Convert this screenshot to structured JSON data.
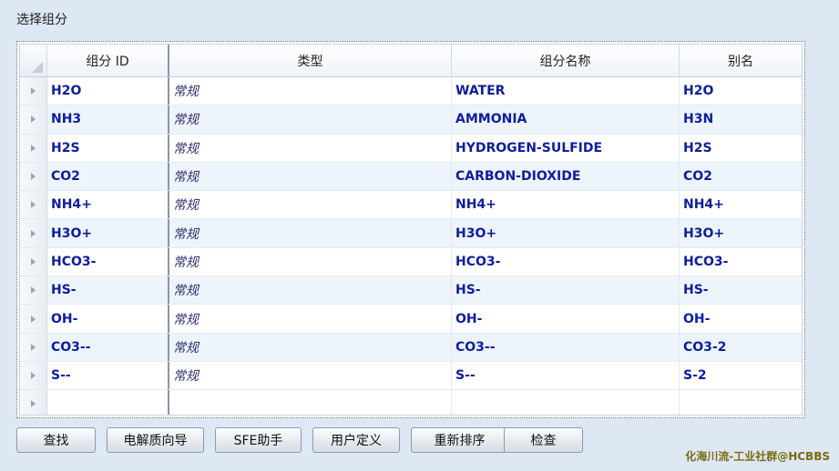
{
  "panel_title": "选择组分",
  "columns": {
    "id": "组分 ID",
    "type": "类型",
    "name": "组分名称",
    "alias": "别名"
  },
  "rows": [
    {
      "id": "H2O",
      "type": "常规",
      "name": "WATER",
      "alias": "H2O"
    },
    {
      "id": "NH3",
      "type": "常规",
      "name": "AMMONIA",
      "alias": "H3N"
    },
    {
      "id": "H2S",
      "type": "常规",
      "name": "HYDROGEN-SULFIDE",
      "alias": "H2S"
    },
    {
      "id": "CO2",
      "type": "常规",
      "name": "CARBON-DIOXIDE",
      "alias": "CO2"
    },
    {
      "id": "NH4+",
      "type": "常规",
      "name": "NH4+",
      "alias": "NH4+"
    },
    {
      "id": "H3O+",
      "type": "常规",
      "name": "H3O+",
      "alias": "H3O+"
    },
    {
      "id": "HCO3-",
      "type": "常规",
      "name": "HCO3-",
      "alias": "HCO3-"
    },
    {
      "id": "HS-",
      "type": "常规",
      "name": "HS-",
      "alias": "HS-"
    },
    {
      "id": "OH-",
      "type": "常规",
      "name": "OH-",
      "alias": "OH-"
    },
    {
      "id": "CO3--",
      "type": "常规",
      "name": "CO3--",
      "alias": "CO3-2"
    },
    {
      "id": "S--",
      "type": "常规",
      "name": "S--",
      "alias": "S-2"
    }
  ],
  "buttons": {
    "find": "查找",
    "electrolyte_wizard": "电解质向导",
    "sfe_assistant": "SFE助手",
    "user_defined": "用户定义",
    "reorder": "重新排序",
    "review": "检查"
  },
  "watermark": "化海川流-工业社群@HCBBS"
}
